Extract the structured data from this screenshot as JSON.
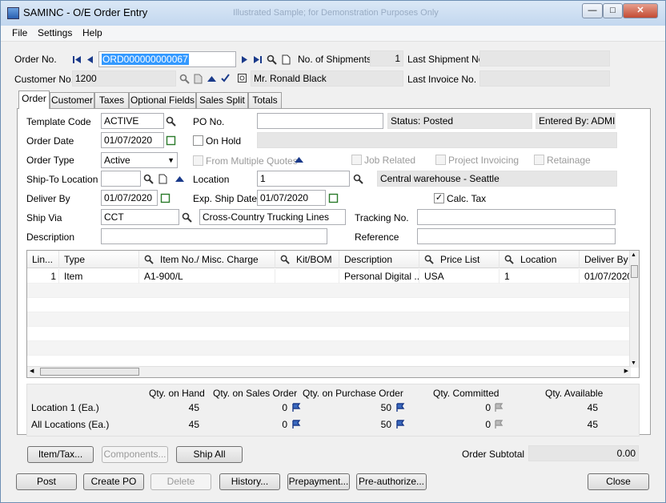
{
  "window": {
    "title": "SAMINC - O/E Order Entry",
    "watermark": "Illustrated Sample; for Demonstration Purposes Only"
  },
  "menu": [
    "File",
    "Settings",
    "Help"
  ],
  "header": {
    "order_no_label": "Order No.",
    "order_no": "ORD000000000067",
    "shipments_label": "No. of Shipments",
    "shipments": "1",
    "last_shipment_label": "Last Shipment No.",
    "last_shipment": "",
    "customer_no_label": "Customer No.",
    "customer_no": "1200",
    "customer_name": "Mr. Ronald Black",
    "last_invoice_label": "Last Invoice No.",
    "last_invoice": ""
  },
  "tabs": [
    "Order",
    "Customer",
    "Taxes",
    "Optional Fields",
    "Sales Split",
    "Totals"
  ],
  "order": {
    "template_code_label": "Template Code",
    "template_code": "ACTIVE",
    "po_no_label": "PO No.",
    "po_no": "",
    "status": "Status: Posted",
    "entered_by": "Entered By: ADMIN",
    "order_date_label": "Order Date",
    "order_date": "01/07/2020",
    "on_hold_label": "On Hold",
    "order_type_label": "Order Type",
    "order_type": "Active",
    "from_quotes_label": "From Multiple Quotes",
    "job_related_label": "Job Related",
    "project_invoicing_label": "Project Invoicing",
    "retainage_label": "Retainage",
    "ship_to_label": "Ship-To Location",
    "ship_to": "",
    "location_label": "Location",
    "location": "1",
    "location_desc": "Central warehouse - Seattle",
    "deliver_by_label": "Deliver By",
    "deliver_by": "01/07/2020",
    "exp_ship_label": "Exp. Ship Date",
    "exp_ship": "01/07/2020",
    "calc_tax_label": "Calc. Tax",
    "ship_via_label": "Ship Via",
    "ship_via": "CCT",
    "ship_via_desc": "Cross-Country Trucking Lines",
    "tracking_label": "Tracking No.",
    "tracking": "",
    "description_label": "Description",
    "description": "",
    "reference_label": "Reference",
    "reference": ""
  },
  "grid": {
    "headers": [
      "Lin...",
      "Type",
      "Item No./ Misc. Charge",
      "Kit/BOM",
      "Description",
      "Price List",
      "Location",
      "Deliver By"
    ],
    "rows": [
      [
        "1",
        "Item",
        "A1-900/L",
        "",
        "Personal Digital ...",
        "USA",
        "1",
        "01/07/2020"
      ]
    ]
  },
  "qty": {
    "headers": [
      "Qty. on Hand",
      "Qty. on Sales Order",
      "Qty. on Purchase Order",
      "Qty. Committed",
      "Qty. Available"
    ],
    "rows": [
      {
        "label": "Location  1 (Ea.)",
        "values": [
          "45",
          "0",
          "50",
          "0",
          "45"
        ]
      },
      {
        "label": "All Locations (Ea.)",
        "values": [
          "45",
          "0",
          "50",
          "0",
          "45"
        ]
      }
    ]
  },
  "buttons": {
    "item_tax": "Item/Tax...",
    "components": "Components...",
    "ship_all": "Ship All",
    "order_subtotal_label": "Order Subtotal",
    "order_subtotal": "0.00",
    "post": "Post",
    "create_po": "Create PO",
    "delete": "Delete",
    "history": "History...",
    "prepayment": "Prepayment...",
    "preauthorize": "Pre-authorize...",
    "close": "Close"
  }
}
